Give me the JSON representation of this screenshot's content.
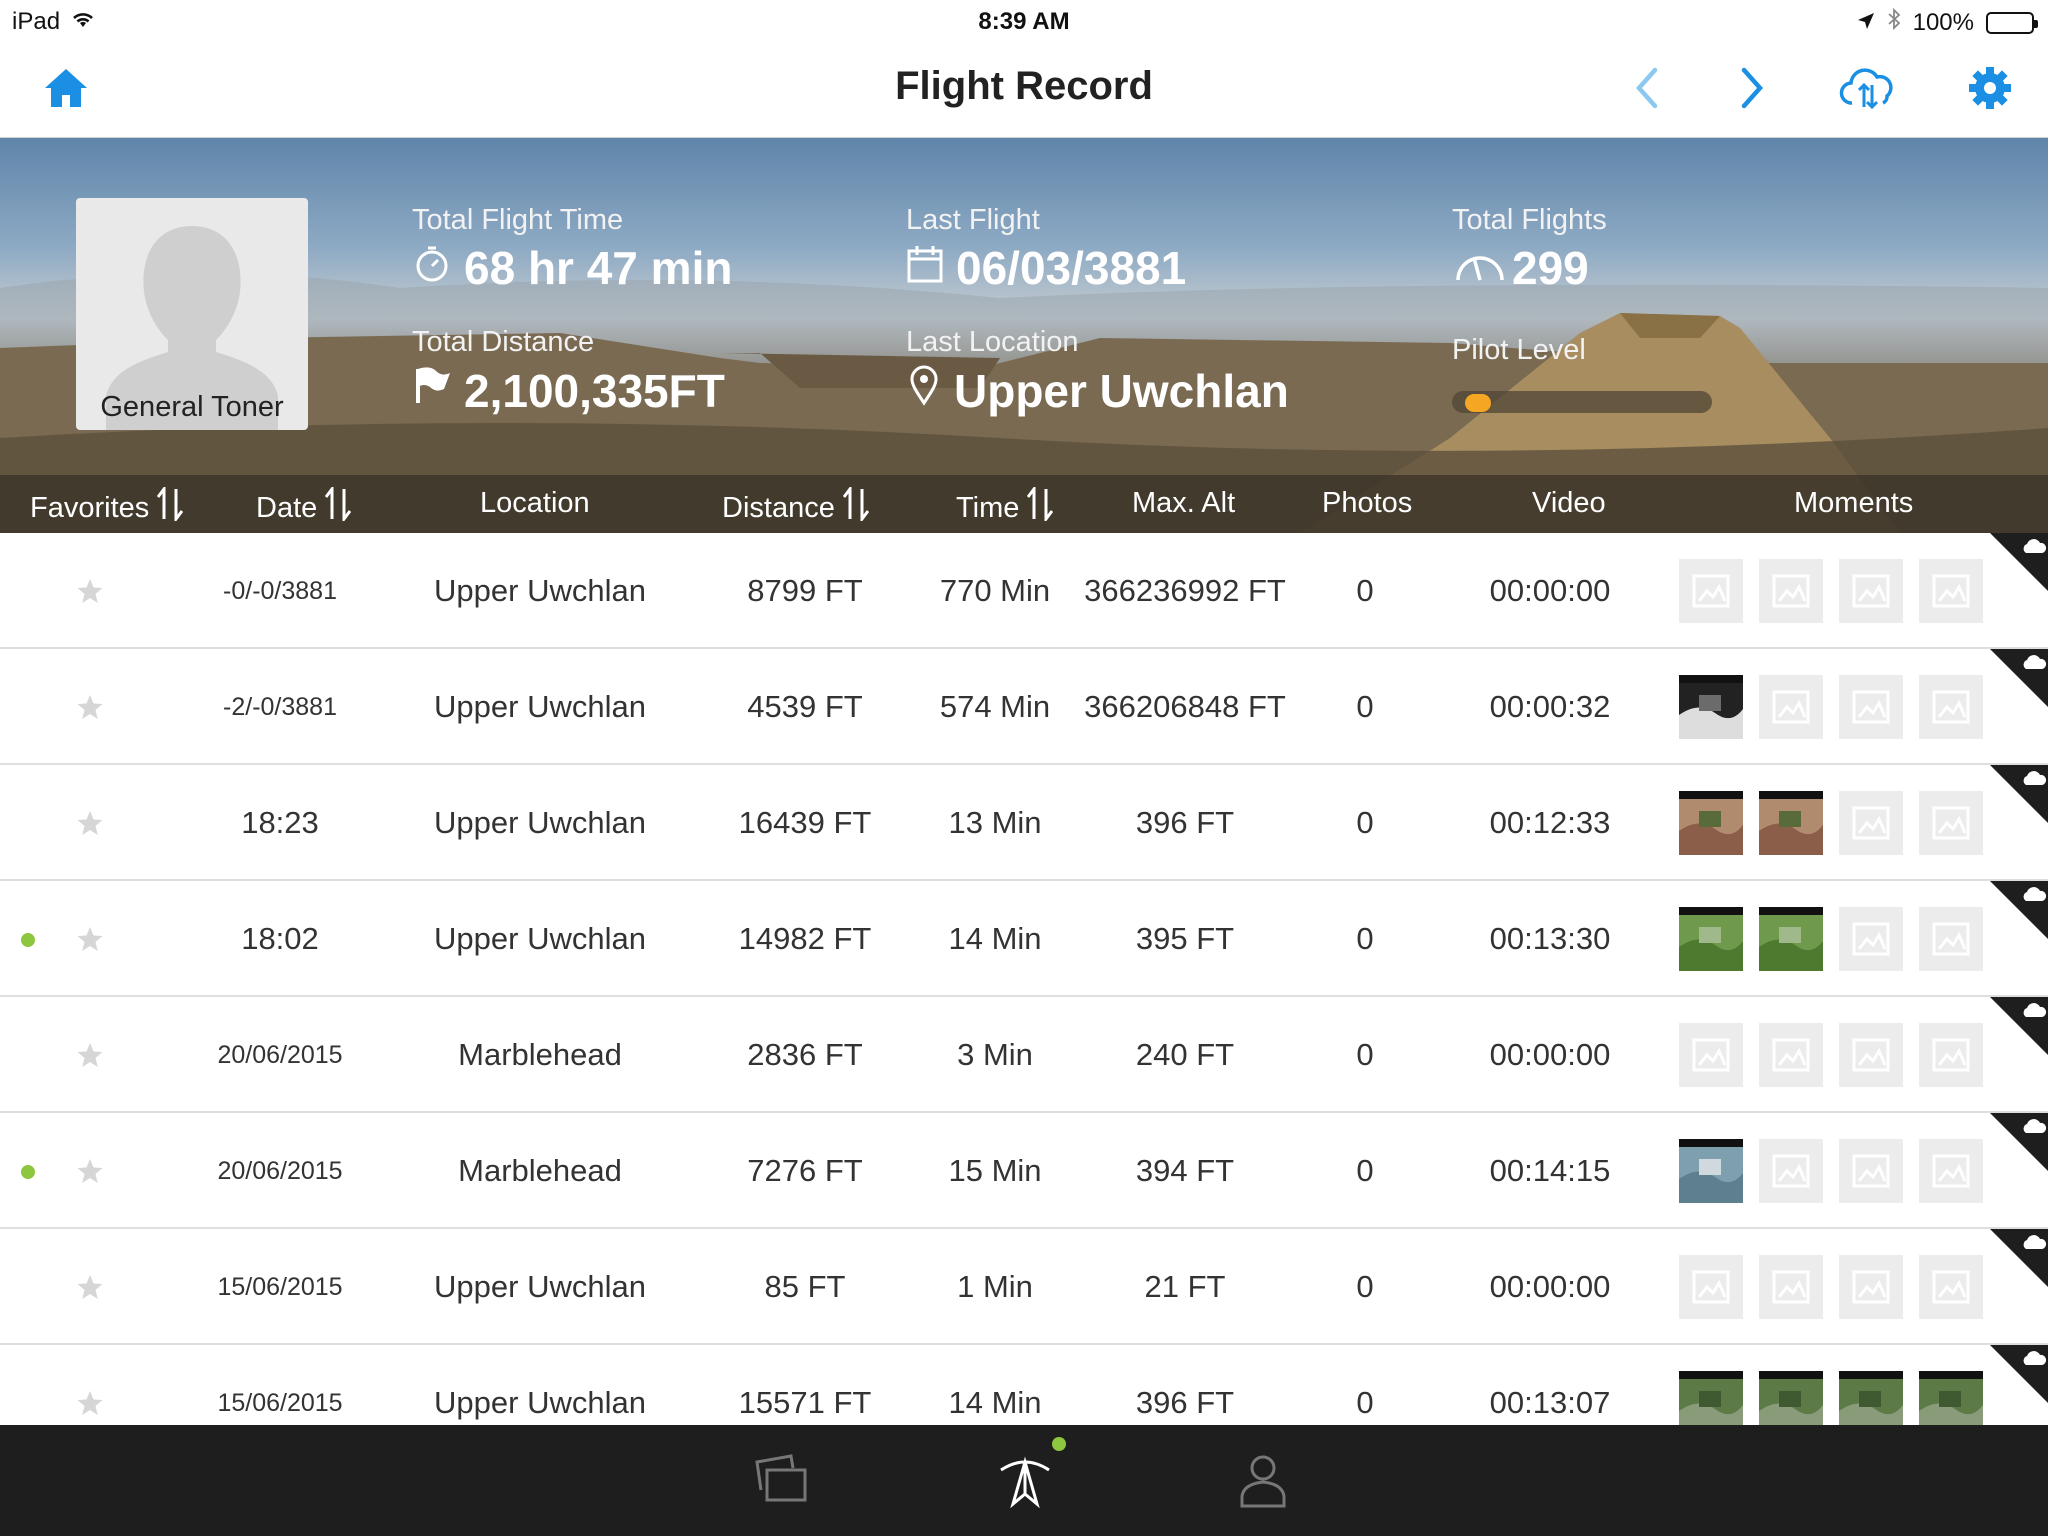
{
  "status_bar": {
    "device": "iPad",
    "time": "8:39 AM",
    "battery": "100%"
  },
  "navbar": {
    "title": "Flight Record"
  },
  "profile": {
    "name": "General Toner"
  },
  "stats": {
    "total_flight_time": {
      "label": "Total Flight Time",
      "value": "68 hr 47 min"
    },
    "last_flight": {
      "label": "Last Flight",
      "value": "06/03/3881"
    },
    "total_flights": {
      "label": "Total Flights",
      "value": "299"
    },
    "total_distance": {
      "label": "Total Distance",
      "value": "2,100,335FT"
    },
    "last_location": {
      "label": "Last Location",
      "value": "Upper Uwchlan"
    },
    "pilot_level": {
      "label": "Pilot Level",
      "progress": 0.05
    }
  },
  "columns": {
    "favorites": "Favorites",
    "date": "Date",
    "location": "Location",
    "distance": "Distance",
    "time": "Time",
    "max_alt": "Max. Alt",
    "photos": "Photos",
    "video": "Video",
    "moments": "Moments"
  },
  "rows": [
    {
      "dot": false,
      "date": "-0/-0/3881",
      "date_small": true,
      "location": "Upper Uwchlan",
      "distance": "8799 FT",
      "time": "770 Min",
      "max_alt": "366236992 FT",
      "photos": "0",
      "video": "00:00:00",
      "thumbs": [
        "empty",
        "empty",
        "empty",
        "empty"
      ]
    },
    {
      "dot": false,
      "date": "-2/-0/3881",
      "date_small": true,
      "location": "Upper Uwchlan",
      "distance": "4539 FT",
      "time": "574 Min",
      "max_alt": "366206848 FT",
      "photos": "0",
      "video": "00:00:32",
      "thumbs": [
        "house",
        "empty",
        "empty",
        "empty"
      ]
    },
    {
      "dot": false,
      "date": "18:23",
      "date_small": false,
      "location": "Upper Uwchlan",
      "distance": "16439 FT",
      "time": "13 Min",
      "max_alt": "396 FT",
      "photos": "0",
      "video": "00:12:33",
      "thumbs": [
        "roof",
        "roof",
        "empty",
        "empty"
      ]
    },
    {
      "dot": true,
      "date": "18:02",
      "date_small": false,
      "location": "Upper Uwchlan",
      "distance": "14982 FT",
      "time": "14 Min",
      "max_alt": "395 FT",
      "photos": "0",
      "video": "00:13:30",
      "thumbs": [
        "field",
        "field",
        "empty",
        "empty"
      ]
    },
    {
      "dot": false,
      "date": "20/06/2015",
      "date_small": true,
      "location": "Marblehead",
      "distance": "2836 FT",
      "time": "3 Min",
      "max_alt": "240 FT",
      "photos": "0",
      "video": "00:00:00",
      "thumbs": [
        "empty",
        "empty",
        "empty",
        "empty"
      ]
    },
    {
      "dot": true,
      "date": "20/06/2015",
      "date_small": true,
      "location": "Marblehead",
      "distance": "7276 FT",
      "time": "15 Min",
      "max_alt": "394 FT",
      "photos": "0",
      "video": "00:14:15",
      "thumbs": [
        "harbor",
        "empty",
        "empty",
        "empty"
      ]
    },
    {
      "dot": false,
      "date": "15/06/2015",
      "date_small": true,
      "location": "Upper Uwchlan",
      "distance": "85 FT",
      "time": "1 Min",
      "max_alt": "21 FT",
      "photos": "0",
      "video": "00:00:00",
      "thumbs": [
        "empty",
        "empty",
        "empty",
        "empty"
      ]
    },
    {
      "dot": false,
      "date": "15/06/2015",
      "date_small": true,
      "location": "Upper Uwchlan",
      "distance": "15571 FT",
      "time": "14 Min",
      "max_alt": "396 FT",
      "photos": "0",
      "video": "00:13:07",
      "thumbs": [
        "aerial",
        "aerial",
        "aerial",
        "aerial"
      ]
    }
  ],
  "colors": {
    "accent": "#1a8fe3",
    "online_dot": "#8dc63f",
    "pilot_level": "#f5a623"
  },
  "tabbar": {
    "items": [
      "library-icon",
      "aircraft-icon",
      "profile-icon"
    ],
    "active": 1
  }
}
